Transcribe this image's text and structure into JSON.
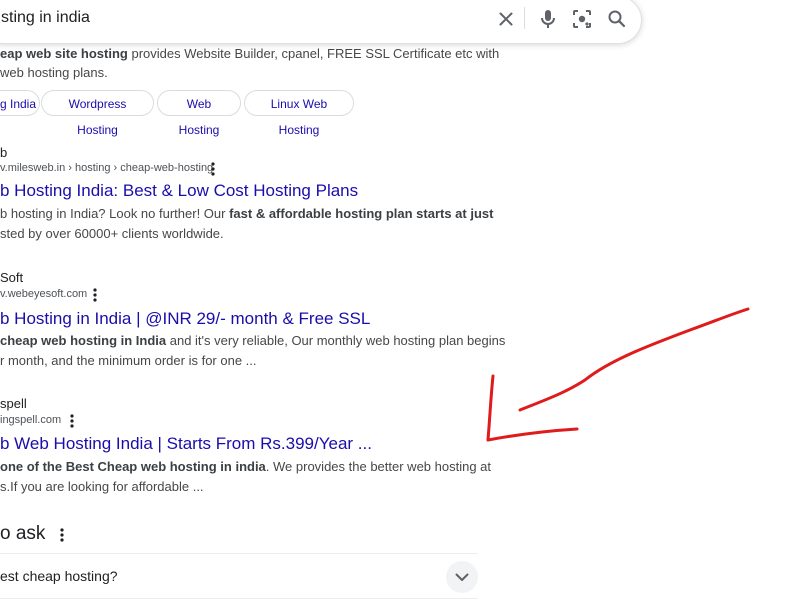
{
  "search": {
    "query": "sting in india",
    "clear_icon": "close-icon",
    "mic_icon": "microphone-icon",
    "lens_icon": "camera-lens-icon",
    "search_icon": "search-icon"
  },
  "top_snippet": {
    "line1_bold": "eap web site hosting",
    "line1_rest": " provides Website Builder, cpanel, FREE SSL Certificate etc with",
    "line2": " web hosting plans."
  },
  "chips": [
    {
      "label": "g India"
    },
    {
      "label": "Wordpress Hosting"
    },
    {
      "label": "Web Hosting"
    },
    {
      "label": "Linux Web Hosting"
    }
  ],
  "results": [
    {
      "site": "b",
      "url": "v.milesweb.in › hosting › cheap-web-hosting",
      "title": "b Hosting India: Best & Low Cost Hosting Plans",
      "s1a": "b hosting in India? Look no further! Our ",
      "s1b": "fast & affordable hosting plan starts at just",
      "s2": "sted by over 60000+ clients worldwide."
    },
    {
      "site": " Soft",
      "url": "v.webeyesoft.com",
      "title": "b Hosting in India | @INR 29/- month & Free SSL",
      "s1a": "cheap web hosting in India",
      "s1b": " and it's very reliable, Our monthly web hosting plan begins",
      "s2": "r month, and the minimum order is for one ..."
    },
    {
      "site": "spell",
      "url": "ingspell.com",
      "title": "b Web Hosting India | Starts From Rs.399/Year ...",
      "s1a": " one of the Best Cheap web hosting in india",
      "s1b": ". We provides the better web hosting at",
      "s2": "s.If you are looking for affordable ..."
    }
  ],
  "paa": {
    "heading": "o ask",
    "question": "est cheap hosting?"
  },
  "colors": {
    "link": "#1a0dab",
    "annotation": "#e01b1b"
  }
}
